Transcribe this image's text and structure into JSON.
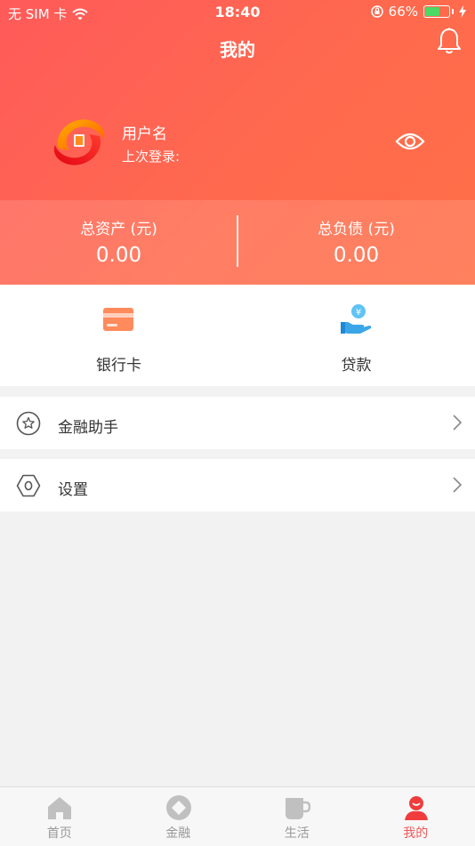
{
  "status_bar": {
    "carrier": "无 SIM 卡",
    "time": "18:40",
    "battery": "66%",
    "battery_level": 0.66
  },
  "header": {
    "title": "我的",
    "username": "用户名",
    "last_login": "上次登录:"
  },
  "assets": {
    "total_assets_label": "总资产 (元)",
    "total_assets_value": "0.00",
    "total_liabilities_label": "总负债 (元)",
    "total_liabilities_value": "0.00"
  },
  "shortcuts": {
    "bank_card": "银行卡",
    "loan": "贷款"
  },
  "menu": {
    "finance_assistant": "金融助手",
    "settings": "设置"
  },
  "tabs": [
    {
      "label": "首页",
      "icon": "home-icon"
    },
    {
      "label": "金融",
      "icon": "finance-icon"
    },
    {
      "label": "生活",
      "icon": "cup-icon"
    },
    {
      "label": "我的",
      "icon": "person-icon"
    }
  ],
  "colors": {
    "header_start": "#ff5a5a",
    "header_end": "#ff6f47",
    "accent": "#f05a5a",
    "inactive_tab": "#c0c0c0"
  }
}
